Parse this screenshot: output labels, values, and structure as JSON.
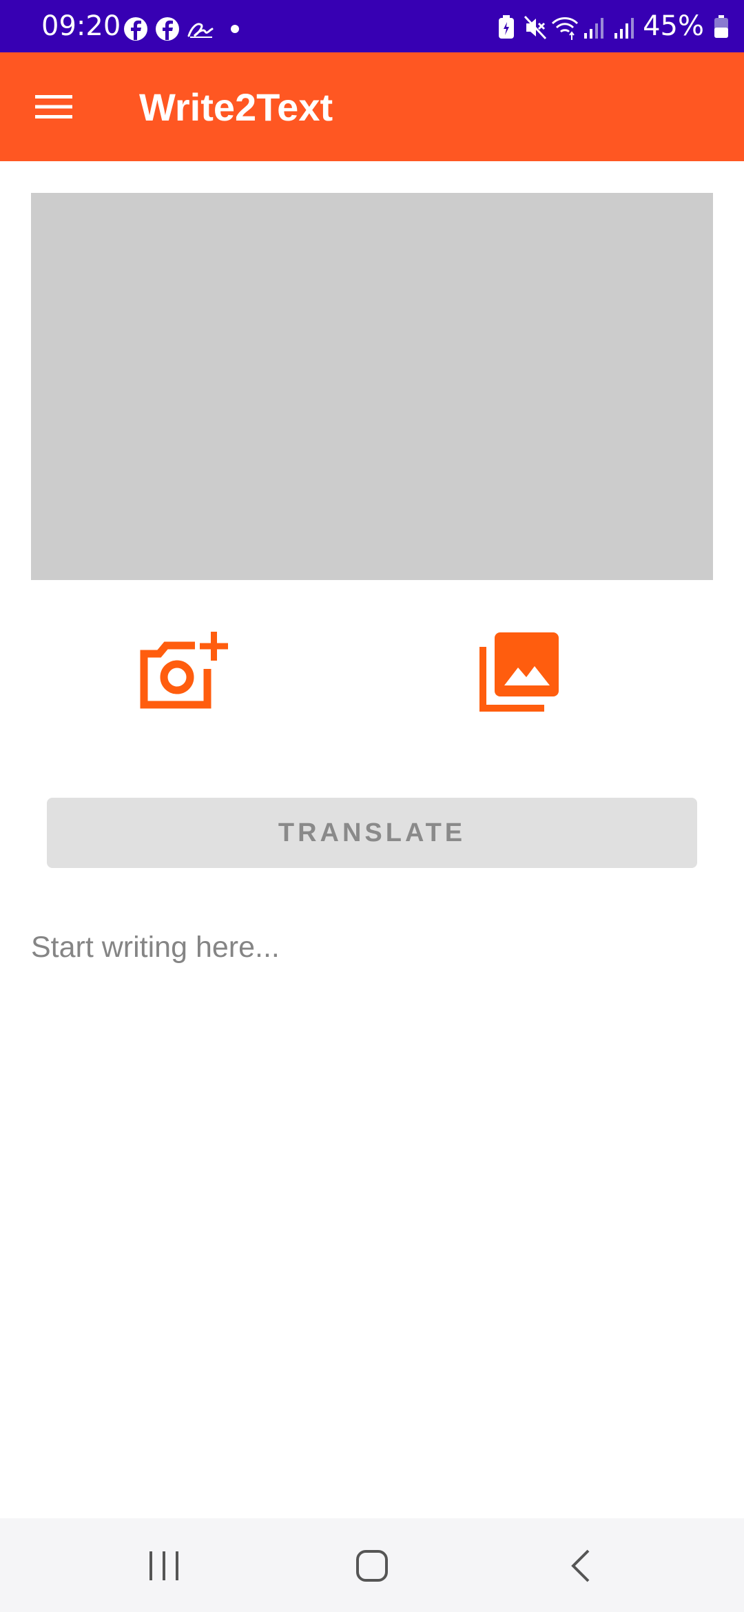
{
  "status_bar": {
    "time": "09:20",
    "battery_percent": "45%",
    "notification_icons": [
      "facebook-icon",
      "facebook-icon",
      "signature-icon",
      "dot-icon"
    ],
    "system_icons": [
      "battery-saver-icon",
      "mute-icon",
      "wifi-icon",
      "signal-icon",
      "signal-icon",
      "battery-icon"
    ],
    "background_color": "#3700b3"
  },
  "app_bar": {
    "title": "Write2Text",
    "menu_icon": "hamburger-menu-icon",
    "background_color": "#ff5722"
  },
  "image_preview": {
    "background_color": "#cccccc"
  },
  "actions": {
    "camera_icon": "add-photo-camera-icon",
    "gallery_icon": "photo-library-icon",
    "accent_color": "#ff5d0e"
  },
  "translate_button": {
    "label": "TRANSLATE",
    "enabled": false
  },
  "text_input": {
    "placeholder": "Start writing here...",
    "value": ""
  },
  "nav_bar": {
    "items": [
      "recent-apps-icon",
      "home-icon",
      "back-icon"
    ]
  }
}
